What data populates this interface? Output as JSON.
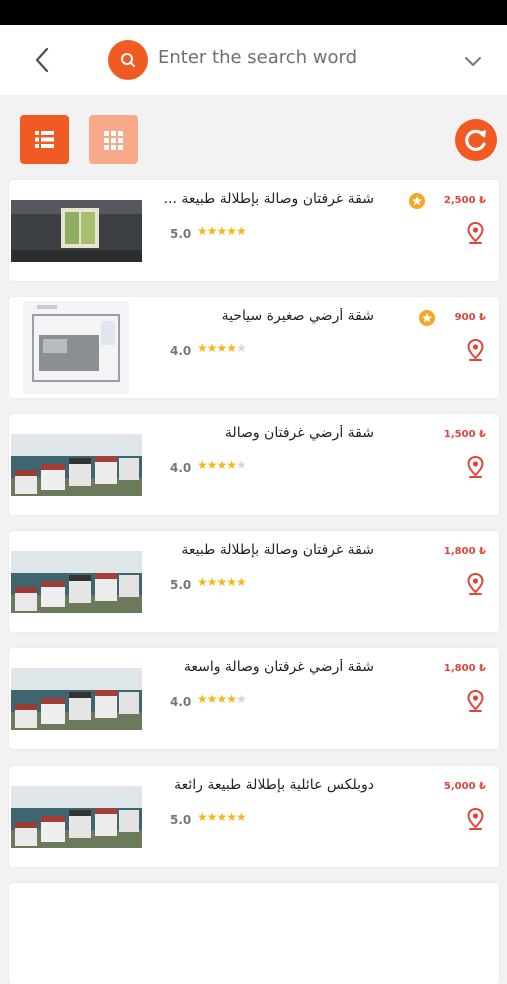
{
  "search": {
    "placeholder": "Enter the search word"
  },
  "colors": {
    "accent": "#f15a22",
    "accent_light": "#f7a98a",
    "star": "#f6b716",
    "price": "#e0453a"
  },
  "icons": {
    "back": "chevron-left-icon",
    "search": "search-icon",
    "dropdown": "chevron-down-icon",
    "list_view": "list-icon",
    "grid_view": "grid-icon",
    "refresh": "refresh-icon",
    "location": "location-pin-icon",
    "featured": "star-badge-icon"
  },
  "listings": [
    {
      "title": "شقة غرفتان وصالة بإطلالة طبيعة ...",
      "price": "2,500 ₺",
      "rating": "5.0",
      "stars": 5,
      "featured": true
    },
    {
      "title": "شقة أرضي صغيرة سياحية",
      "price": "900 ₺",
      "rating": "4.0",
      "stars": 4,
      "featured": true
    },
    {
      "title": "شقة أرضي غرفتان وصالة",
      "price": "1,500 ₺",
      "rating": "4.0",
      "stars": 4,
      "featured": false
    },
    {
      "title": "شقة غرفتان وصالة بإطلالة طبيعة",
      "price": "1,800 ₺",
      "rating": "5.0",
      "stars": 5,
      "featured": false
    },
    {
      "title": "شقة أرضي غرفتان وصالة واسعة",
      "price": "1,800 ₺",
      "rating": "4.0",
      "stars": 4,
      "featured": false
    },
    {
      "title": "دوبلكس عائلية بإطلالة طبيعة رائعة",
      "price": "5,000 ₺",
      "rating": "5.0",
      "stars": 5,
      "featured": false
    }
  ]
}
